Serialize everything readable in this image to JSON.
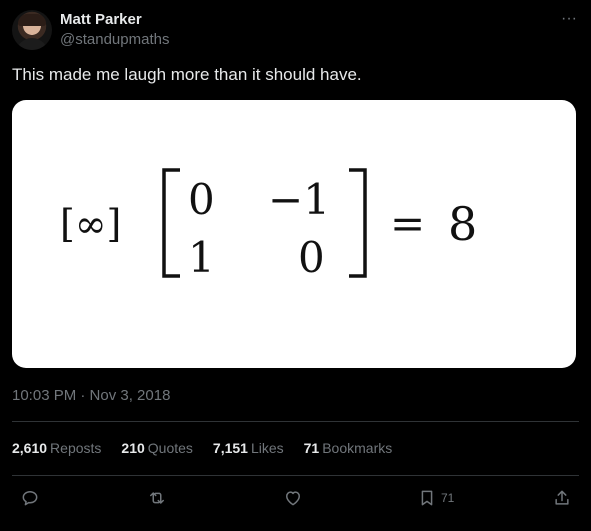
{
  "author": {
    "name": "Matt Parker",
    "handle": "@standupmaths"
  },
  "more_label": "···",
  "tweet_text": "This made me laugh more than it should have.",
  "media": {
    "equation": {
      "left_bracket_content": "[∞]",
      "matrix": [
        [
          "0",
          "−1"
        ],
        [
          "1",
          "0"
        ]
      ],
      "equals": "=",
      "result": "8"
    }
  },
  "timestamp": "10:03 PM · Nov 3, 2018",
  "stats": {
    "reposts_count": "2,610",
    "reposts_label": "Reposts",
    "quotes_count": "210",
    "quotes_label": "Quotes",
    "likes_count": "7,151",
    "likes_label": "Likes",
    "bookmarks_count": "71",
    "bookmarks_label": "Bookmarks"
  },
  "actions": {
    "reply_icon": "reply-icon",
    "repost_icon": "repost-icon",
    "like_icon": "heart-icon",
    "bookmark_icon": "bookmark-icon",
    "bookmark_count": "71",
    "share_icon": "share-icon"
  },
  "colors": {
    "background": "#000000",
    "text": "#e7e9ea",
    "secondary": "#71767b",
    "divider": "#2f3336"
  }
}
